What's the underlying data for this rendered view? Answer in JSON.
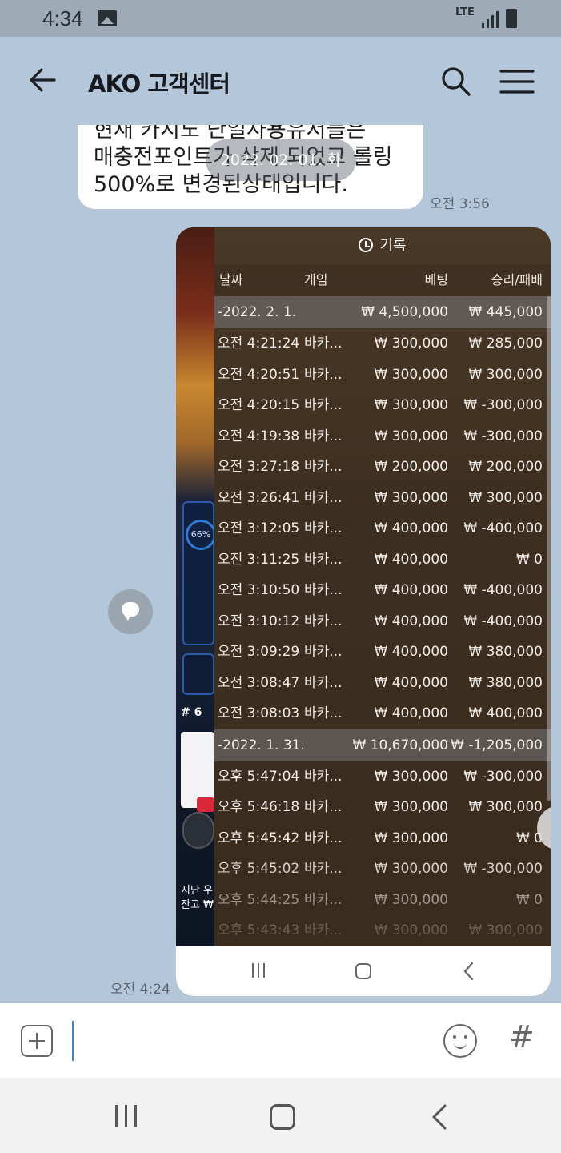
{
  "status_bar": {
    "time": "4:34",
    "network": "LTE"
  },
  "header": {
    "title": "AKO 고객센터"
  },
  "messages": {
    "received_lines": [
      "현재 카지노 단일사용유저들은",
      "매충전포인트가 삭제 되었고 롤링",
      "500%로 변경된상태입니다."
    ],
    "received_time": "오전 3:56",
    "date_overlay": "2022. 02. 01. 화",
    "image_time": "오전 4:24"
  },
  "screenshot": {
    "title": "기록",
    "columns": {
      "date": "날짜",
      "game": "게임",
      "bet": "베팅",
      "result": "승리/패배"
    },
    "side": {
      "percent": "66%",
      "table_no": "# 6",
      "line1": "지난 우",
      "line2": "잔고 ₩"
    },
    "rows": [
      {
        "date": "-2022. 2. 1.",
        "game": "",
        "bet": "₩ 4,500,000",
        "result": "₩ 445,000",
        "is_date": true
      },
      {
        "date": "오전 4:21:24",
        "game": "바카...",
        "bet": "₩ 300,000",
        "result": "₩ 285,000"
      },
      {
        "date": "오전 4:20:51",
        "game": "바카...",
        "bet": "₩ 300,000",
        "result": "₩ 300,000"
      },
      {
        "date": "오전 4:20:15",
        "game": "바카...",
        "bet": "₩ 300,000",
        "result": "₩ -300,000"
      },
      {
        "date": "오전 4:19:38",
        "game": "바카...",
        "bet": "₩ 300,000",
        "result": "₩ -300,000"
      },
      {
        "date": "오전 3:27:18",
        "game": "바카...",
        "bet": "₩ 200,000",
        "result": "₩ 200,000"
      },
      {
        "date": "오전 3:26:41",
        "game": "바카...",
        "bet": "₩ 300,000",
        "result": "₩ 300,000"
      },
      {
        "date": "오전 3:12:05",
        "game": "바카...",
        "bet": "₩ 400,000",
        "result": "₩ -400,000"
      },
      {
        "date": "오전 3:11:25",
        "game": "바카...",
        "bet": "₩ 400,000",
        "result": "₩ 0"
      },
      {
        "date": "오전 3:10:50",
        "game": "바카...",
        "bet": "₩ 400,000",
        "result": "₩ -400,000"
      },
      {
        "date": "오전 3:10:12",
        "game": "바카...",
        "bet": "₩ 400,000",
        "result": "₩ -400,000"
      },
      {
        "date": "오전 3:09:29",
        "game": "바카...",
        "bet": "₩ 400,000",
        "result": "₩ 380,000"
      },
      {
        "date": "오전 3:08:47",
        "game": "바카...",
        "bet": "₩ 400,000",
        "result": "₩ 380,000"
      },
      {
        "date": "오전 3:08:03",
        "game": "바카...",
        "bet": "₩ 400,000",
        "result": "₩ 400,000"
      },
      {
        "date": "-2022. 1. 31.",
        "game": "",
        "bet": "₩ 10,670,000",
        "result": "₩ -1,205,000",
        "is_date": true
      },
      {
        "date": "오후 5:47:04",
        "game": "바카...",
        "bet": "₩ 300,000",
        "result": "₩ -300,000"
      },
      {
        "date": "오후 5:46:18",
        "game": "바카...",
        "bet": "₩ 300,000",
        "result": "₩ 300,000"
      },
      {
        "date": "오후 5:45:42",
        "game": "바카...",
        "bet": "₩ 300,000",
        "result": "₩ 0"
      },
      {
        "date": "오후 5:45:02",
        "game": "바카...",
        "bet": "₩ 300,000",
        "result": "₩ -300,000"
      },
      {
        "date": "오후 5:44:25",
        "game": "바카...",
        "bet": "₩ 300,000",
        "result": "₩ 0"
      },
      {
        "date": "오후 5:43:43",
        "game": "바카...",
        "bet": "₩ 300,000",
        "result": "₩ 300,000"
      }
    ]
  },
  "input": {
    "placeholder": "",
    "value": ""
  },
  "icons": {
    "back": "arrow-left-icon",
    "search": "search-icon",
    "menu": "hamburger-menu-icon",
    "plus": "plus-icon",
    "emoji": "emoji-icon",
    "hashtag": "hashtag-icon",
    "close": "close-icon",
    "history": "history-clock-icon",
    "chat": "chat-bubble-icon"
  },
  "colors": {
    "chat_bg": "#b3c6da",
    "bubble_bg": "#ffffff",
    "panel_bg": "#3a2c1e",
    "accent": "#3a86c8"
  }
}
